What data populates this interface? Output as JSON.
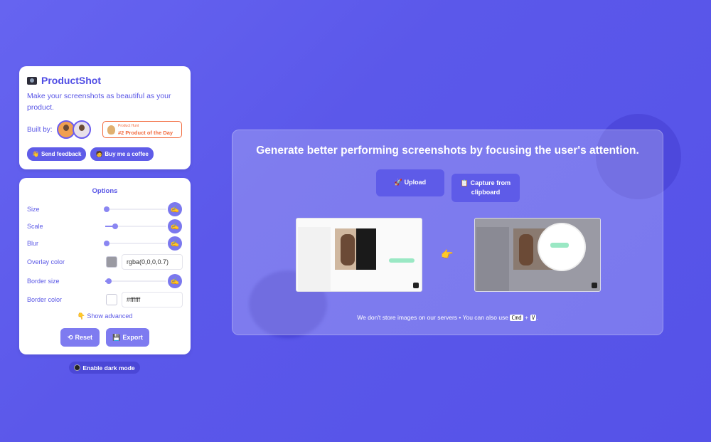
{
  "brand": {
    "name": "ProductShot",
    "tagline": "Make your screenshots as beautiful as your product.",
    "built_by": "Built by:"
  },
  "badge": {
    "small": "Product Hunt",
    "big": "#2 Product of the Day"
  },
  "links": {
    "feedback": "Send feedback",
    "coffee": "Buy me a coffee"
  },
  "options": {
    "title": "Options",
    "rows": [
      {
        "label": "Size",
        "value": 0.0
      },
      {
        "label": "Scale",
        "value": 0.17
      },
      {
        "label": "Blur",
        "value": 0.0
      },
      {
        "label": "Overlay color",
        "color": "rgba(0,0,0,0.7)",
        "text": "rgba(0,0,0,0.7)"
      },
      {
        "label": "Border size",
        "value": 0.06
      },
      {
        "label": "Border color",
        "color": "#ffffff",
        "text": "#ffffff"
      }
    ],
    "advanced": "Show advanced",
    "reset": "Reset",
    "export": "Export"
  },
  "dark_mode": "Enable dark mode",
  "main": {
    "headline": "Generate better performing screenshots by focusing the user's attention.",
    "upload": "Upload",
    "capture": "Capture from clipboard",
    "footer_pre": "We don't store images on our servers • You can also use",
    "key1": "Cmd",
    "plus": "+",
    "key2": "V",
    "footer_post": "."
  },
  "colors": {
    "accent": "#5f5ce8",
    "background": "#5b58ea",
    "badge": "#f26a3d"
  }
}
